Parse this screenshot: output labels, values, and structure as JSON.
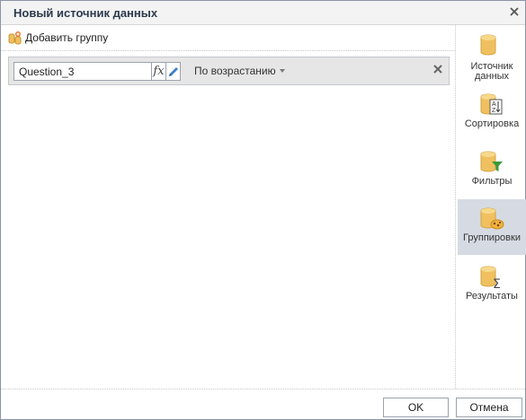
{
  "dialog": {
    "title": "Новый источник данных"
  },
  "toolbar": {
    "add_group_label": "Добавить группу"
  },
  "group": {
    "field_value": "Question_3",
    "fx_label": "fx",
    "order_label": "По возрастанию"
  },
  "sidebar": {
    "items": [
      {
        "label": "Источник данных",
        "icon": "database-icon",
        "active": false
      },
      {
        "label": "Сортировка",
        "icon": "sort-az-icon",
        "active": false
      },
      {
        "label": "Фильтры",
        "icon": "filter-icon",
        "active": false
      },
      {
        "label": "Группировки",
        "icon": "grouping-icon",
        "active": true
      },
      {
        "label": "Результаты",
        "icon": "sum-icon",
        "active": false
      }
    ]
  },
  "footer": {
    "ok_label": "OK",
    "cancel_label": "Отмена"
  },
  "colors": {
    "active_item_bg": "#d6dbe3",
    "db_yellow": "#f0c060",
    "filter_green": "#3a9a3a"
  }
}
